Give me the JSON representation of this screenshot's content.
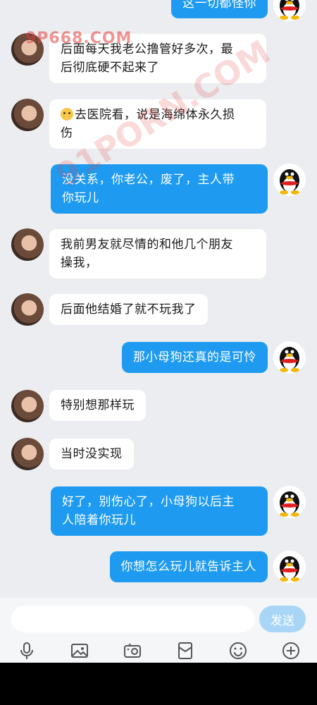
{
  "messages": [
    {
      "side": "out",
      "text": "这一切都怪你"
    },
    {
      "side": "in",
      "lines": [
        "后面每天我老公撸管好多次，最",
        "后彻底硬不起来了"
      ]
    },
    {
      "side": "in",
      "emoji": "sweat-emoji",
      "lines": [
        "去医院看，说是海绵体永久损",
        "伤"
      ]
    },
    {
      "side": "out",
      "lines": [
        "没关系，你老公，废了，主人带",
        "你玩儿"
      ]
    },
    {
      "side": "in",
      "lines": [
        "我前男友就尽情的和他几个朋友",
        "操我，"
      ]
    },
    {
      "side": "in",
      "lines": [
        "后面他结婚了就不玩我了"
      ]
    },
    {
      "side": "out",
      "lines": [
        "那小母狗还真的是可怜"
      ]
    },
    {
      "side": "in",
      "lines": [
        "特别想那样玩"
      ]
    },
    {
      "side": "in",
      "lines": [
        "当时没实现"
      ]
    },
    {
      "side": "out",
      "lines": [
        "好了，别伤心了，小母狗以后主",
        "人陪着你玩儿"
      ]
    },
    {
      "side": "out",
      "lines": [
        "你想怎么玩儿就告诉主人"
      ]
    }
  ],
  "watermarks": {
    "top": "9P668.COM",
    "diagonal": "91PORN.COM"
  },
  "input": {
    "value": "",
    "placeholder": ""
  },
  "send_label": "发送",
  "toolbar_icons": [
    "microphone-icon",
    "image-icon",
    "camera-icon",
    "red-envelope-icon",
    "emoji-icon",
    "plus-icon"
  ],
  "colors": {
    "outgoing_bubble": "#1e9bf0",
    "incoming_bubble": "#ffffff",
    "background": "#ebedf0",
    "send_button": "#a9d6f7"
  }
}
